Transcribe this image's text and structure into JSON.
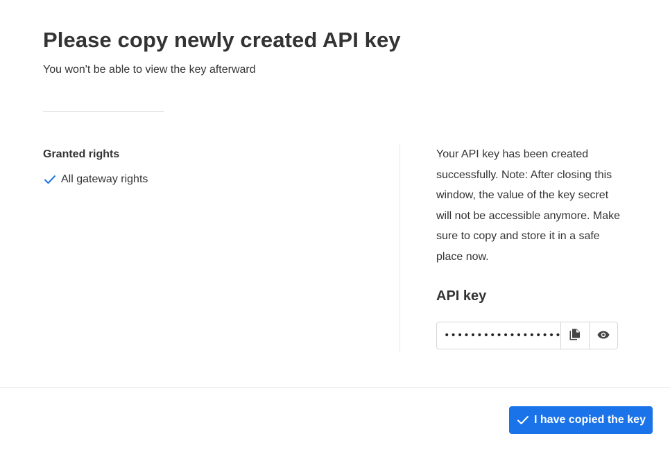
{
  "dialog": {
    "title": "Please copy newly created API key",
    "subtitle": "You won't be able to view the key afterward"
  },
  "rights": {
    "heading": "Granted rights",
    "items": [
      {
        "label": "All gateway rights",
        "icon": "checkmark-icon"
      }
    ]
  },
  "info": {
    "note": "Your API key has been created successfully. Note: After closing this window, the value of the key secret will not be accessible anymore. Make sure to copy and store it in a safe place now."
  },
  "api_key": {
    "label": "API key",
    "value": "••••••••••••••••••••",
    "copy_icon": "copy-icon",
    "reveal_icon": "eye-icon"
  },
  "footer": {
    "confirm_label": "I have copied the key",
    "confirm_icon": "checkmark-icon"
  },
  "colors": {
    "accent": "#1a73e8",
    "text": "#333333",
    "divider": "#e3e3e3"
  }
}
